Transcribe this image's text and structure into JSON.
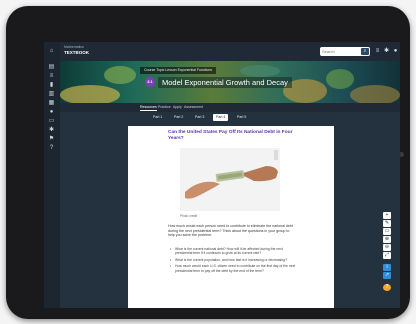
{
  "colors": {
    "accent_purple": "#5b34a8",
    "unit_badge": "#7b3fb5",
    "dark_ui": "#24313f",
    "info_blue": "#2e8ed8",
    "help_orange": "#f4a62a"
  },
  "brand": {
    "sub": "Mathematics",
    "name": "TEXTBOOK"
  },
  "search": {
    "placeholder": "Search",
    "button_icon": "search-icon"
  },
  "top_icons": [
    "menu-icon",
    "settings-icon",
    "user-icon"
  ],
  "left_rail_icons": [
    "home-icon",
    "book-icon",
    "list-icon",
    "bookmark-icon",
    "chart-icon",
    "calendar-icon",
    "people-icon",
    "notes-icon",
    "settings-icon",
    "flag-icon",
    "help-icon"
  ],
  "hero": {
    "breadcrumb": "Course  Topic  Lesson  Exponential Functions",
    "unit": "3.1",
    "title": "Model Exponential Growth and Decay"
  },
  "hero_tabs": [
    "Resources",
    "Practice",
    "Apply",
    "Assessment"
  ],
  "lesson_nav": {
    "items": [
      "Part 1",
      "Part 2",
      "Part 3",
      "Part 4",
      "Part 5"
    ],
    "active_index": 0
  },
  "content": {
    "question": "Can the United States Pay Off Its National Debt in Four Years?",
    "caption": "Photo credit",
    "body": "How much would each person need to contribute to eliminate the national debt during the next presidential term? Think about the questions in your group to help you solve the problem.",
    "bullets": [
      "What is the current national debt? How will it be affected during the next presidential term if it continues to grow at its current rate?",
      "What is the current population, and how fast is it increasing or decreasing?",
      "How much would each U.S. citizen need to contribute on the first day of the next presidential term to pay off the debt by the end of the term?"
    ]
  },
  "right_tools": [
    "plus-icon",
    "pencil-icon",
    "eraser-icon",
    "zoom-in-icon",
    "zoom-out-icon",
    "fullscreen-icon",
    "info-icon",
    "share-icon",
    "help-icon"
  ]
}
